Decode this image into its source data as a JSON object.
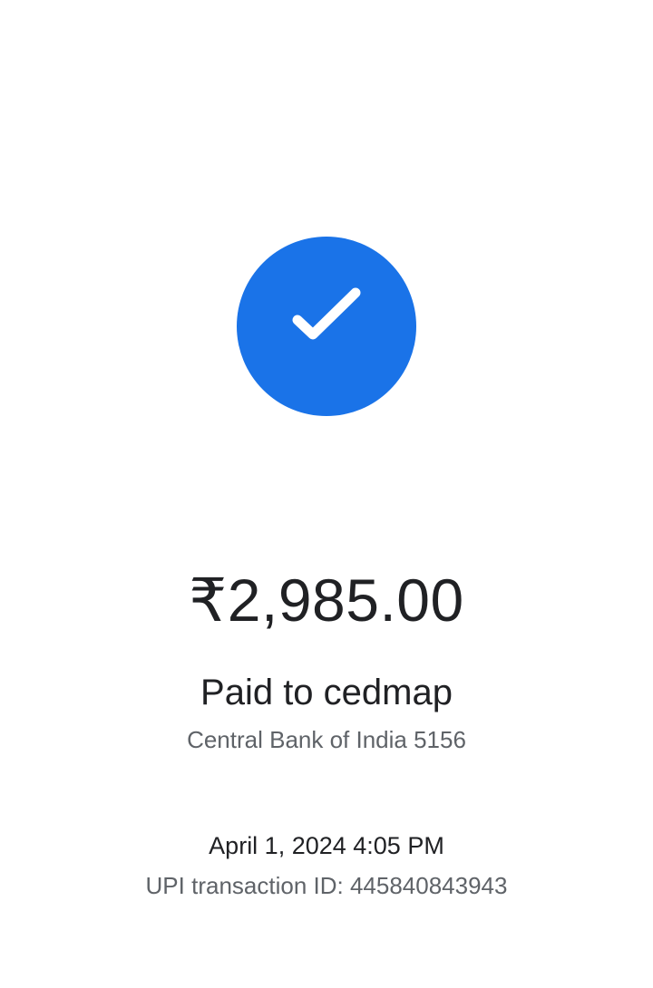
{
  "status": {
    "icon": "check-icon",
    "circle_color": "#1a73e8"
  },
  "payment": {
    "amount": "₹2,985.00",
    "paid_to": "Paid to cedmap",
    "bank": "Central Bank of India 5156",
    "datetime": "April 1, 2024 4:05 PM",
    "transaction_id": "UPI transaction ID: 445840843943"
  }
}
